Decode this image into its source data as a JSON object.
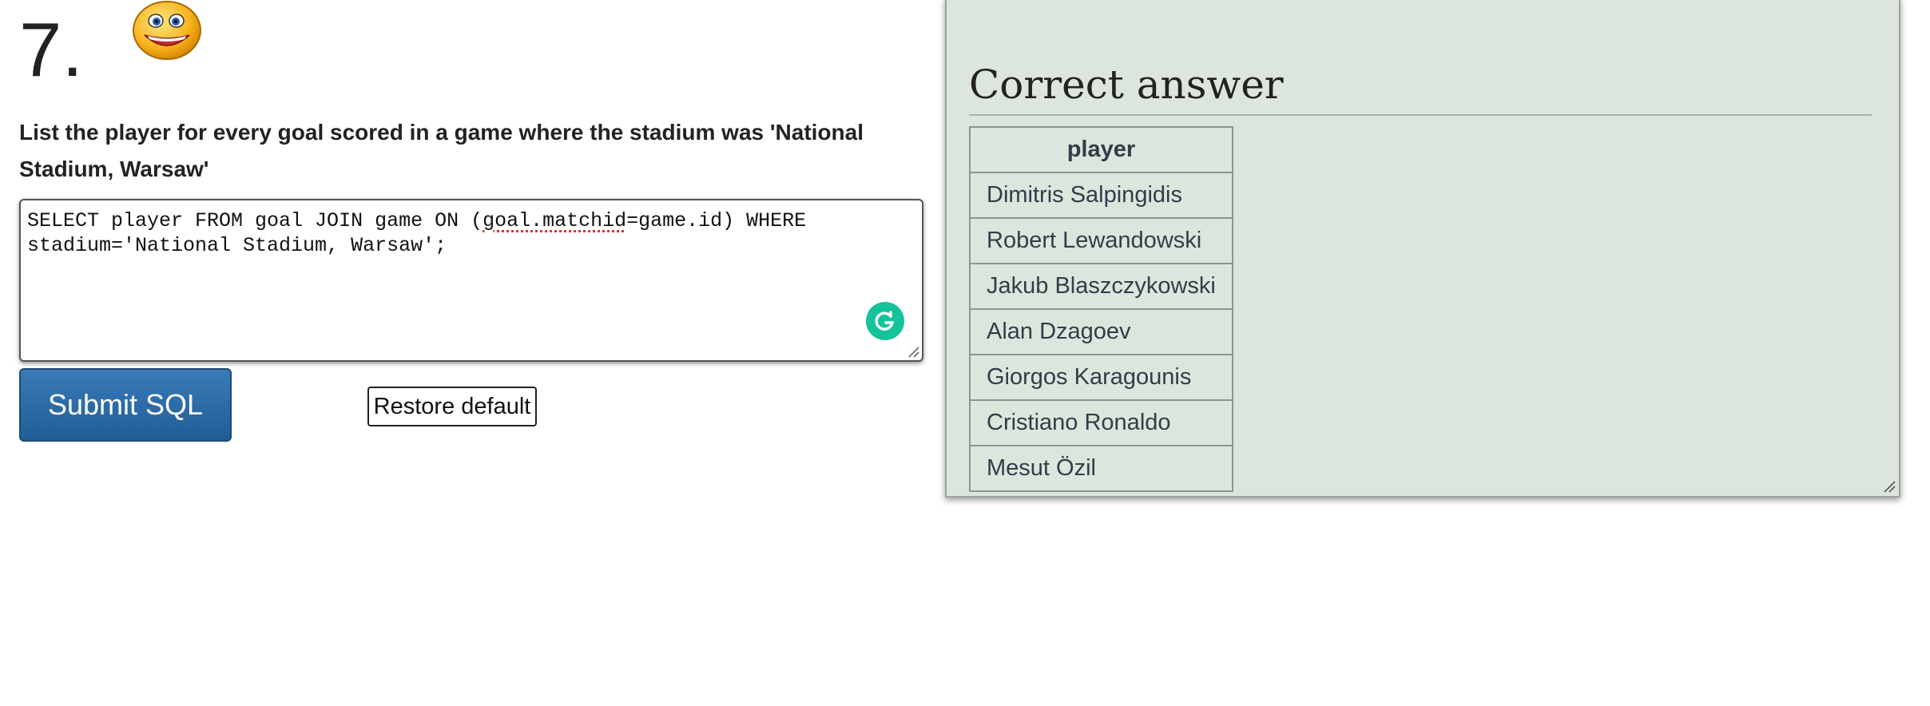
{
  "question": {
    "number": "7.",
    "text": "List the player for every goal scored in a game where the stadium was 'National Stadium, Warsaw'"
  },
  "editor": {
    "sql_before": "SELECT player FROM goal JOIN game ON (",
    "sql_flagged": "goal.matchid",
    "sql_after": "=game.id) WHERE\nstadium='National Stadium, Warsaw';",
    "grammarly_icon": "grammarly-g-icon",
    "grammarly_color": "#15c39a"
  },
  "buttons": {
    "submit_label": "Submit SQL",
    "restore_label": "Restore default",
    "submit_color": "#2a6aa5"
  },
  "answer": {
    "title": "Correct answer",
    "column_header": "player",
    "rows": [
      "Dimitris Salpingidis",
      "Robert Lewandowski",
      "Jakub Blaszczykowski",
      "Alan Dzagoev",
      "Giorgos Karagounis",
      "Cristiano Ronaldo",
      "Mesut Özil"
    ],
    "panel_color": "#dce6dc"
  },
  "icons": {
    "result_indicator": "smiley-face-icon"
  }
}
